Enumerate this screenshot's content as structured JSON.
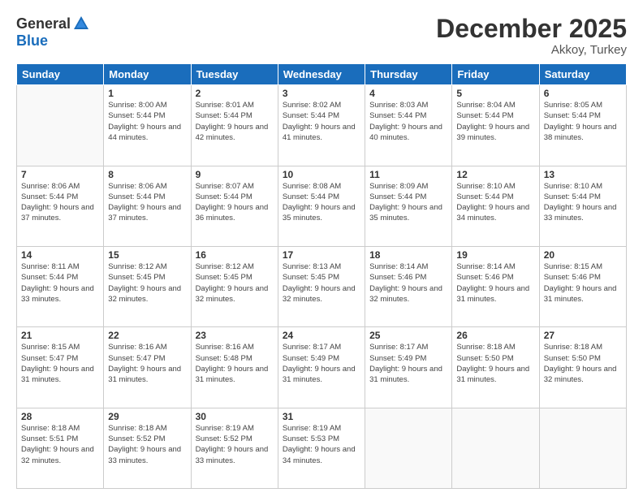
{
  "header": {
    "logo_general": "General",
    "logo_blue": "Blue",
    "month_title": "December 2025",
    "location": "Akkoy, Turkey"
  },
  "weekdays": [
    "Sunday",
    "Monday",
    "Tuesday",
    "Wednesday",
    "Thursday",
    "Friday",
    "Saturday"
  ],
  "weeks": [
    [
      {
        "day": "",
        "empty": true
      },
      {
        "day": "1",
        "sunrise": "8:00 AM",
        "sunset": "5:44 PM",
        "daylight": "9 hours and 44 minutes."
      },
      {
        "day": "2",
        "sunrise": "8:01 AM",
        "sunset": "5:44 PM",
        "daylight": "9 hours and 42 minutes."
      },
      {
        "day": "3",
        "sunrise": "8:02 AM",
        "sunset": "5:44 PM",
        "daylight": "9 hours and 41 minutes."
      },
      {
        "day": "4",
        "sunrise": "8:03 AM",
        "sunset": "5:44 PM",
        "daylight": "9 hours and 40 minutes."
      },
      {
        "day": "5",
        "sunrise": "8:04 AM",
        "sunset": "5:44 PM",
        "daylight": "9 hours and 39 minutes."
      },
      {
        "day": "6",
        "sunrise": "8:05 AM",
        "sunset": "5:44 PM",
        "daylight": "9 hours and 38 minutes."
      }
    ],
    [
      {
        "day": "7",
        "sunrise": "8:06 AM",
        "sunset": "5:44 PM",
        "daylight": "9 hours and 37 minutes."
      },
      {
        "day": "8",
        "sunrise": "8:06 AM",
        "sunset": "5:44 PM",
        "daylight": "9 hours and 37 minutes."
      },
      {
        "day": "9",
        "sunrise": "8:07 AM",
        "sunset": "5:44 PM",
        "daylight": "9 hours and 36 minutes."
      },
      {
        "day": "10",
        "sunrise": "8:08 AM",
        "sunset": "5:44 PM",
        "daylight": "9 hours and 35 minutes."
      },
      {
        "day": "11",
        "sunrise": "8:09 AM",
        "sunset": "5:44 PM",
        "daylight": "9 hours and 35 minutes."
      },
      {
        "day": "12",
        "sunrise": "8:10 AM",
        "sunset": "5:44 PM",
        "daylight": "9 hours and 34 minutes."
      },
      {
        "day": "13",
        "sunrise": "8:10 AM",
        "sunset": "5:44 PM",
        "daylight": "9 hours and 33 minutes."
      }
    ],
    [
      {
        "day": "14",
        "sunrise": "8:11 AM",
        "sunset": "5:44 PM",
        "daylight": "9 hours and 33 minutes."
      },
      {
        "day": "15",
        "sunrise": "8:12 AM",
        "sunset": "5:45 PM",
        "daylight": "9 hours and 32 minutes."
      },
      {
        "day": "16",
        "sunrise": "8:12 AM",
        "sunset": "5:45 PM",
        "daylight": "9 hours and 32 minutes."
      },
      {
        "day": "17",
        "sunrise": "8:13 AM",
        "sunset": "5:45 PM",
        "daylight": "9 hours and 32 minutes."
      },
      {
        "day": "18",
        "sunrise": "8:14 AM",
        "sunset": "5:46 PM",
        "daylight": "9 hours and 32 minutes."
      },
      {
        "day": "19",
        "sunrise": "8:14 AM",
        "sunset": "5:46 PM",
        "daylight": "9 hours and 31 minutes."
      },
      {
        "day": "20",
        "sunrise": "8:15 AM",
        "sunset": "5:46 PM",
        "daylight": "9 hours and 31 minutes."
      }
    ],
    [
      {
        "day": "21",
        "sunrise": "8:15 AM",
        "sunset": "5:47 PM",
        "daylight": "9 hours and 31 minutes."
      },
      {
        "day": "22",
        "sunrise": "8:16 AM",
        "sunset": "5:47 PM",
        "daylight": "9 hours and 31 minutes."
      },
      {
        "day": "23",
        "sunrise": "8:16 AM",
        "sunset": "5:48 PM",
        "daylight": "9 hours and 31 minutes."
      },
      {
        "day": "24",
        "sunrise": "8:17 AM",
        "sunset": "5:49 PM",
        "daylight": "9 hours and 31 minutes."
      },
      {
        "day": "25",
        "sunrise": "8:17 AM",
        "sunset": "5:49 PM",
        "daylight": "9 hours and 31 minutes."
      },
      {
        "day": "26",
        "sunrise": "8:18 AM",
        "sunset": "5:50 PM",
        "daylight": "9 hours and 31 minutes."
      },
      {
        "day": "27",
        "sunrise": "8:18 AM",
        "sunset": "5:50 PM",
        "daylight": "9 hours and 32 minutes."
      }
    ],
    [
      {
        "day": "28",
        "sunrise": "8:18 AM",
        "sunset": "5:51 PM",
        "daylight": "9 hours and 32 minutes."
      },
      {
        "day": "29",
        "sunrise": "8:18 AM",
        "sunset": "5:52 PM",
        "daylight": "9 hours and 33 minutes."
      },
      {
        "day": "30",
        "sunrise": "8:19 AM",
        "sunset": "5:52 PM",
        "daylight": "9 hours and 33 minutes."
      },
      {
        "day": "31",
        "sunrise": "8:19 AM",
        "sunset": "5:53 PM",
        "daylight": "9 hours and 34 minutes."
      },
      {
        "day": "",
        "empty": true
      },
      {
        "day": "",
        "empty": true
      },
      {
        "day": "",
        "empty": true
      }
    ]
  ]
}
